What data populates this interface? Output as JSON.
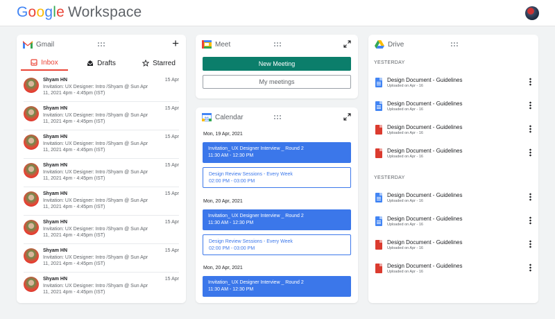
{
  "app": {
    "logo_google": [
      "G",
      "o",
      "o",
      "g",
      "l",
      "e"
    ],
    "logo_suffix": "Workspace"
  },
  "colors": {
    "accent_red": "#ea4335",
    "meet_green": "#0b7e6b",
    "calendar_blue": "#3b77ea",
    "doc_blue": "#4285f4",
    "pdf_red": "#db3b2f"
  },
  "gmail": {
    "title": "Gmail",
    "compose_icon": "plus-icon",
    "tabs": [
      {
        "label": "Inbox",
        "icon": "inbox-icon"
      },
      {
        "label": "Drafts",
        "icon": "drafts-icon"
      },
      {
        "label": "Starred",
        "icon": "star-icon"
      }
    ],
    "messages": [
      {
        "sender": "Shyam HN",
        "date": "15 Apr",
        "snippet": "Invitation: UX Designer: Intro /Shyam @ Sun Apr 11, 2021 4pm - 4:45pm (IST)"
      },
      {
        "sender": "Shyam HN",
        "date": "15 Apr",
        "snippet": "Invitation: UX Designer: Intro /Shyam @ Sun Apr 11, 2021 4pm - 4:45pm (IST)"
      },
      {
        "sender": "Shyam HN",
        "date": "15 Apr",
        "snippet": "Invitation: UX Designer: Intro /Shyam @ Sun Apr 11, 2021 4pm - 4:45pm (IST)"
      },
      {
        "sender": "Shyam HN",
        "date": "15 Apr",
        "snippet": "Invitation: UX Designer: Intro /Shyam @ Sun Apr 11, 2021 4pm - 4:45pm (IST)"
      },
      {
        "sender": "Shyam HN",
        "date": "15 Apr",
        "snippet": "Invitation: UX Designer: Intro /Shyam @ Sun Apr 11, 2021 4pm - 4:45pm (IST)"
      },
      {
        "sender": "Shyam HN",
        "date": "15 Apr",
        "snippet": "Invitation: UX Designer: Intro /Shyam @ Sun Apr 11, 2021 4pm - 4:45pm (IST)"
      },
      {
        "sender": "Shyam HN",
        "date": "15 Apr",
        "snippet": "Invitation: UX Designer: Intro /Shyam @ Sun Apr 11, 2021 4pm - 4:45pm (IST)"
      },
      {
        "sender": "Shyam HN",
        "date": "15 Apr",
        "snippet": "Invitation: UX Designer: Intro /Shyam @ Sun Apr 11, 2021 4pm - 4:45pm (IST)"
      }
    ]
  },
  "meet": {
    "title": "Meet",
    "new_meeting": "New Meeting",
    "my_meetings": "My meetings"
  },
  "calendar": {
    "title": "Calendar",
    "days": [
      {
        "date": "Mon, 19 Apr, 2021",
        "events": [
          {
            "title": "Invitation_ UX Designer Interview _ Round 2",
            "time": "11:30 AM - 12:30 PM",
            "style": "solid"
          },
          {
            "title": "Design Review Sessions - Every Week",
            "time": "02:00 PM - 03:00 PM",
            "style": "outline"
          }
        ]
      },
      {
        "date": "Mon, 20 Apr, 2021",
        "events": [
          {
            "title": "Invitation_ UX Designer Interview _ Round 2",
            "time": "11:30 AM - 12:30 PM",
            "style": "solid"
          },
          {
            "title": "Design Review Sessions - Every Week",
            "time": "02:00 PM - 03:00 PM",
            "style": "outline"
          }
        ]
      },
      {
        "date": "Mon, 20 Apr, 2021",
        "events": [
          {
            "title": "Invitation_ UX Designer Interview _ Round 2",
            "time": "11:30 AM - 12:30 PM",
            "style": "solid"
          }
        ]
      }
    ]
  },
  "drive": {
    "title": "Drive",
    "sections": [
      {
        "label": "YESTERDAY",
        "files": [
          {
            "name": "Design Document - Guidelines",
            "meta": "Uploaded on Apr - 16",
            "type": "doc"
          },
          {
            "name": "Design Document - Guidelines",
            "meta": "Uploaded on Apr - 16",
            "type": "doc"
          },
          {
            "name": "Design Document - Guidelines",
            "meta": "Uploaded on Apr - 16",
            "type": "pdf"
          },
          {
            "name": "Design Document - Guidelines",
            "meta": "Uploaded on Apr - 16",
            "type": "pdf"
          }
        ]
      },
      {
        "label": "YESTERDAY",
        "files": [
          {
            "name": "Design Document - Guidelines",
            "meta": "Uploaded on Apr - 16",
            "type": "doc"
          },
          {
            "name": "Design Document - Guidelines",
            "meta": "Uploaded on Apr - 16",
            "type": "doc"
          },
          {
            "name": "Design Document - Guidelines",
            "meta": "Uploaded on Apr - 16",
            "type": "pdf"
          },
          {
            "name": "Design Document - Guidelines",
            "meta": "Uploaded on Apr - 16",
            "type": "pdf"
          }
        ]
      }
    ]
  }
}
